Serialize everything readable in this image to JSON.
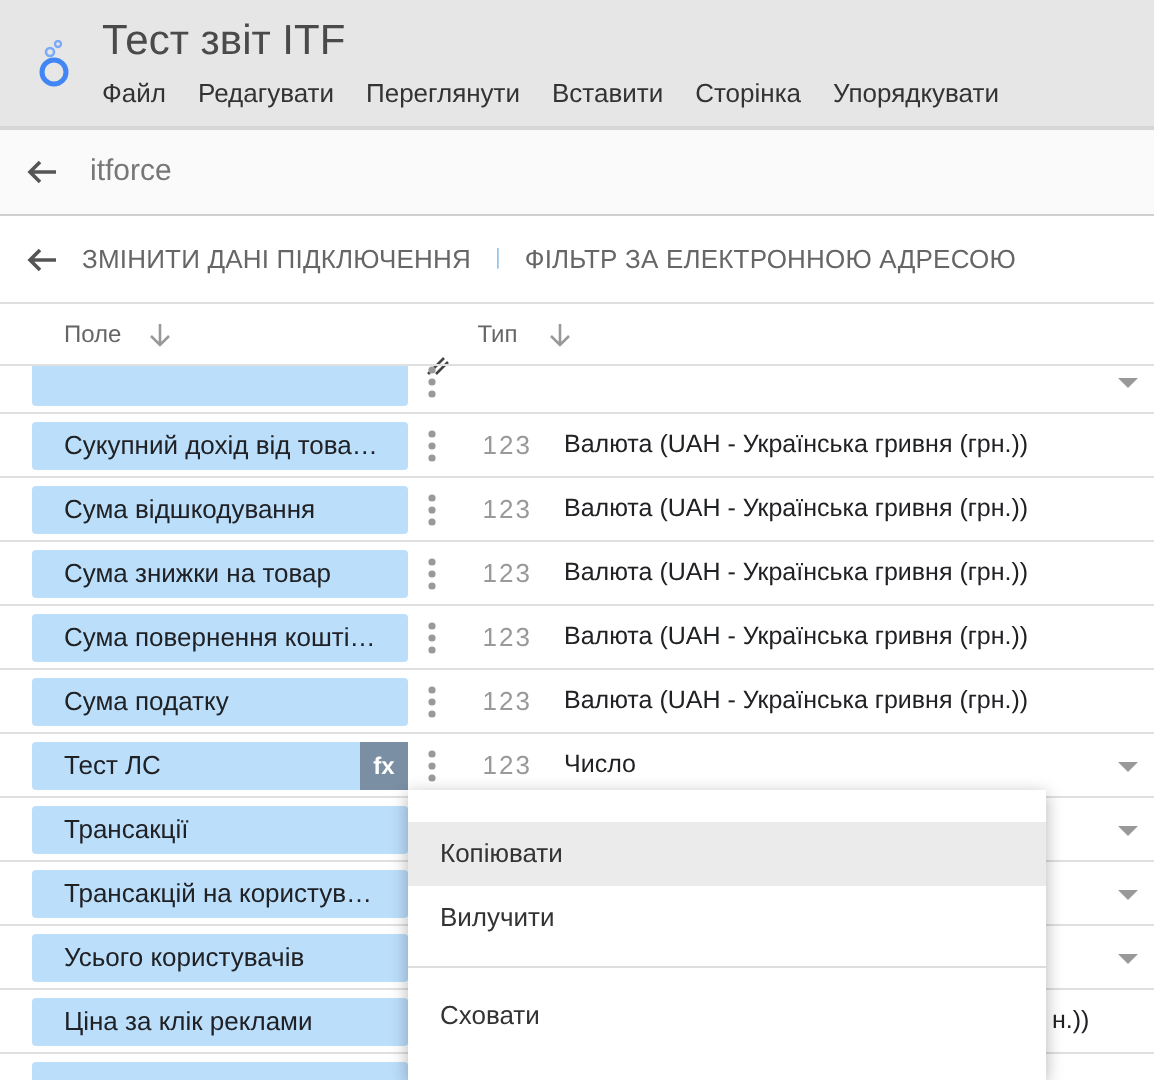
{
  "app": {
    "title": "Тест звіт ITF",
    "menu": [
      "Файл",
      "Редагувати",
      "Переглянути",
      "Вставити",
      "Сторінка",
      "Упорядкувати"
    ]
  },
  "source": {
    "name": "itforce"
  },
  "toolbar": {
    "edit_connection": "ЗМІНИТИ ДАНІ ПІДКЛЮЧЕННЯ",
    "separator": "|",
    "filter": "ФІЛЬТР ЗА ЕЛЕКТРОННОЮ АДРЕСОЮ"
  },
  "table": {
    "columns": [
      "Поле",
      "Тип"
    ],
    "rows": [
      {
        "kind": "clipped",
        "dropdown": true,
        "calculated": false
      },
      {
        "kind": "full",
        "field": "Сукупний дохід від това…",
        "type_icon": "123",
        "type": "Валюта (UAH - Українська гривня (грн.))",
        "dropdown": false,
        "calculated": false
      },
      {
        "kind": "full",
        "field": "Сума відшкодування",
        "type_icon": "123",
        "type": "Валюта (UAH - Українська гривня (грн.))",
        "dropdown": false,
        "calculated": false
      },
      {
        "kind": "full",
        "field": "Сума знижки на товар",
        "type_icon": "123",
        "type": "Валюта (UAH - Українська гривня (грн.))",
        "dropdown": false,
        "calculated": false
      },
      {
        "kind": "full",
        "field": "Сума повернення кошті…",
        "type_icon": "123",
        "type": "Валюта (UAH - Українська гривня (грн.))",
        "dropdown": false,
        "calculated": false
      },
      {
        "kind": "full",
        "field": "Сума податку",
        "type_icon": "123",
        "type": "Валюта (UAH - Українська гривня (грн.))",
        "dropdown": false,
        "calculated": false
      },
      {
        "kind": "full",
        "field": "Тест ЛС",
        "type_icon": "123",
        "type": "Число",
        "dropdown": true,
        "calculated": true,
        "calc_label": "fx"
      },
      {
        "kind": "covered",
        "field": "Трансакції",
        "dropdown": true,
        "calculated": false
      },
      {
        "kind": "covered",
        "field": "Трансакцій на користув…",
        "dropdown": true,
        "calculated": false
      },
      {
        "kind": "covered",
        "field": "Усього користувачів",
        "dropdown": true,
        "calculated": false
      },
      {
        "kind": "covered",
        "field": "Ціна за клік реклами",
        "type": "н.))",
        "dropdown": false,
        "calculated": false
      },
      {
        "kind": "clipped",
        "dropdown": false,
        "calculated": false
      }
    ]
  },
  "context_menu": {
    "items": [
      {
        "label": "Копіювати",
        "selected": true
      },
      {
        "label": "Вилучити",
        "selected": false
      },
      {
        "label": "Сховати",
        "selected": false,
        "divider_before": true
      }
    ]
  }
}
